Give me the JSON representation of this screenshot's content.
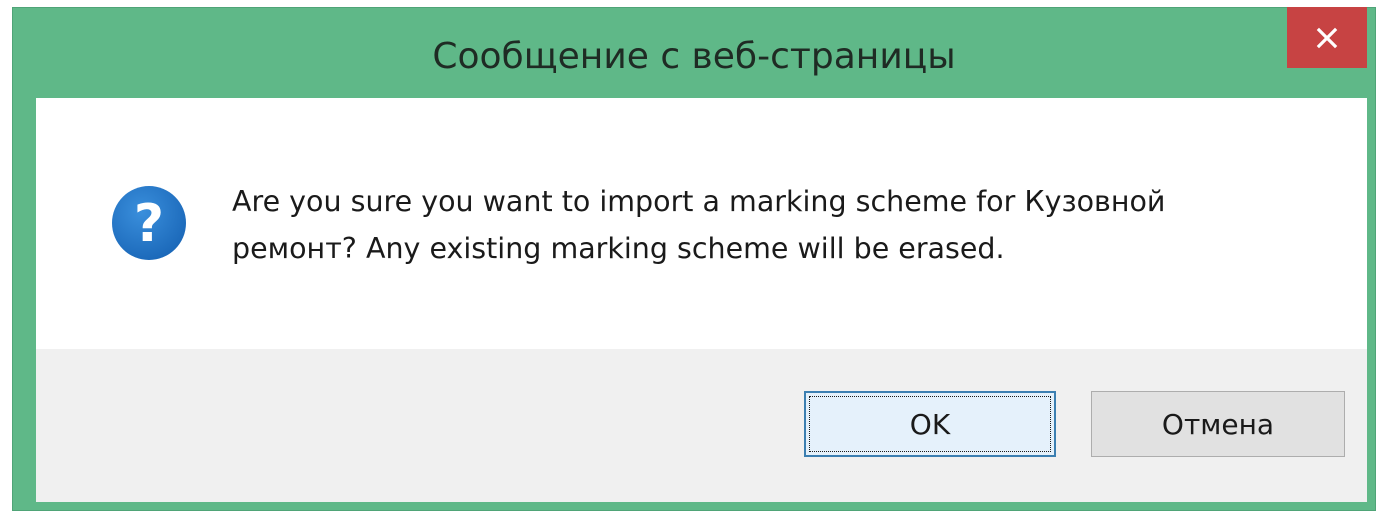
{
  "dialog": {
    "title": "Сообщение с веб-страницы",
    "message_line1": "Are you sure you want to import a marking scheme for Кузовной",
    "message_line2": "ремонт? Any existing marking scheme will be erased.",
    "icon": "question-icon",
    "buttons": {
      "ok_label": "OK",
      "cancel_label": "Отмена"
    }
  },
  "colors": {
    "frame": "#5fb888",
    "close_button": "#c74343",
    "icon_blue": "#1f75c9",
    "button_bar": "#f0f0f0",
    "ok_border": "#3c7fb1"
  }
}
